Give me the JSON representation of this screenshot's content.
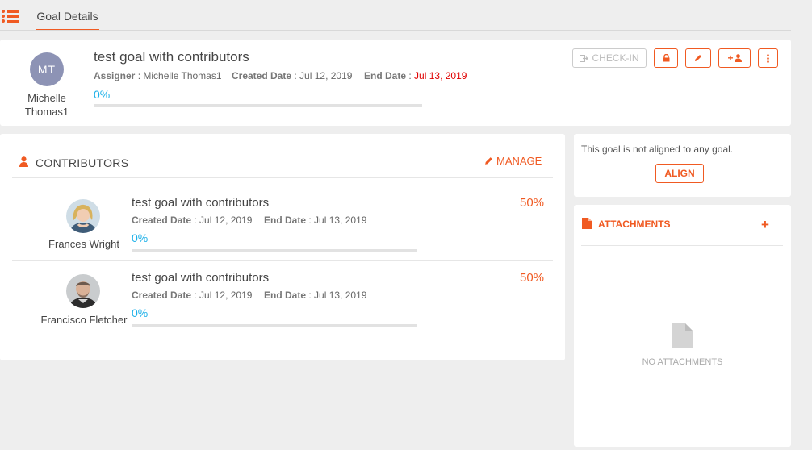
{
  "nav": {
    "tab_label": "Goal Details"
  },
  "goal": {
    "owner_initials": "MT",
    "owner_name": "Michelle Thomas1",
    "title": "test goal with contributors",
    "assigner_label": "Assigner",
    "assigner_value": ": Michelle Thomas1",
    "created_label": "Created Date",
    "created_value": ": Jul 12, 2019",
    "end_label": "End Date",
    "end_value": "Jul 13, 2019",
    "end_separator": ":",
    "progress_text": "0%",
    "progress": 0
  },
  "actions": {
    "checkin_label": "CHECK-IN"
  },
  "contributors": {
    "heading": "CONTRIBUTORS",
    "manage_label": "MANAGE",
    "items": [
      {
        "name": "Frances Wright",
        "title": "test goal with contributors",
        "created_label": "Created Date",
        "created_value": ": Jul 12, 2019",
        "end_label": "End Date",
        "end_value": ": Jul 13, 2019",
        "progress_text": "0%",
        "progress": 0,
        "weight": "50%"
      },
      {
        "name": "Francisco Fletcher",
        "title": "test goal with contributors",
        "created_label": "Created Date",
        "created_value": ": Jul 12, 2019",
        "end_label": "End Date",
        "end_value": ": Jul 13, 2019",
        "progress_text": "0%",
        "progress": 0,
        "weight": "50%"
      }
    ]
  },
  "alignment": {
    "message": "This goal is not aligned to any goal.",
    "align_label": "ALIGN"
  },
  "attachments": {
    "heading": "ATTACHMENTS",
    "empty_text": "NO ATTACHMENTS"
  },
  "colors": {
    "accent": "#f05a22",
    "progress": "#1cb0e8",
    "due_date": "#e00000",
    "avatar": "#8d93b5"
  }
}
